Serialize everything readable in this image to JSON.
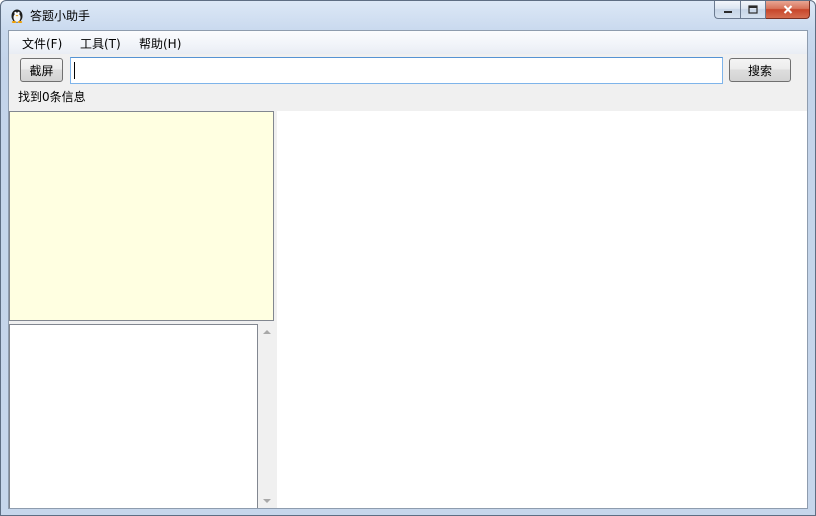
{
  "window": {
    "title": "答题小助手"
  },
  "menu": {
    "items": [
      {
        "label": "文件(F)"
      },
      {
        "label": "工具(T)"
      },
      {
        "label": "帮助(H)"
      }
    ]
  },
  "toolbar": {
    "screenshot_label": "截屏",
    "search_label": "搜索",
    "search_value": ""
  },
  "status": {
    "text": "找到0条信息"
  },
  "colors": {
    "info_panel_bg": "#ffffe1",
    "client_bg": "#f0f0f0",
    "input_border": "#7eb4ea"
  },
  "icons": {
    "app": "penguin-icon",
    "minimize": "minimize-icon",
    "maximize": "maximize-icon",
    "close": "close-icon"
  }
}
